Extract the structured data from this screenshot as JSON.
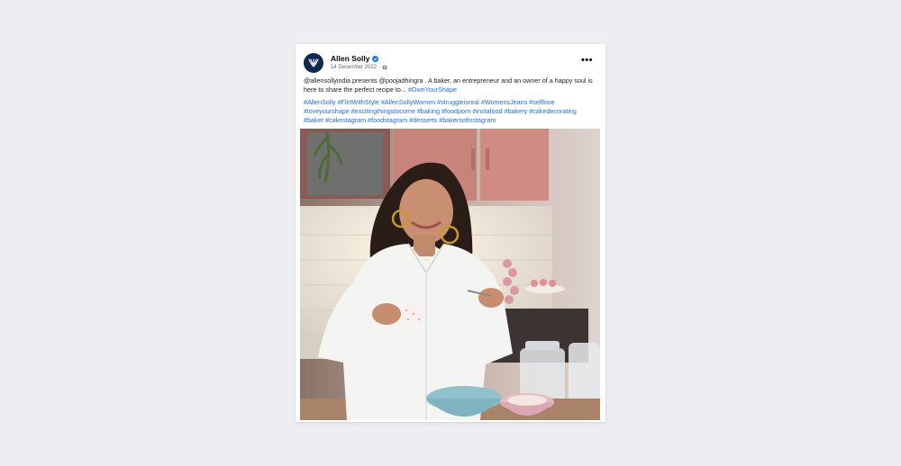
{
  "post": {
    "author": "Allen Solly",
    "date": "14 December 2022",
    "date_sep": "·",
    "more_glyph": "•••",
    "caption": {
      "mention_brand": "@allensollyindia",
      "presents": " presents ",
      "mention_person": "@poojadhingra",
      "text": " . A baker, an entrepreneur and an owner of a happy soul is here to share the perfect recipe to... ",
      "tag_own": "#OwnYourShape"
    },
    "hashtags": [
      "#AllenSolly",
      "#FlirtWithStyle",
      "#AllenSollyWomen",
      "#struggleisreal",
      "#WomensJeans",
      "#selflove",
      "#loveyourshape",
      "#excitingthingstocome",
      "#baking",
      "#foodporn",
      "#instafood",
      "#bakery",
      "#cakedecorating",
      "#baker",
      "#cakestagram",
      "#foodstagram",
      "#desserts",
      "#bakersofinstagram"
    ],
    "icons": {
      "avatar": "allen-solly-logo",
      "verified": "verified-badge-icon",
      "audience": "globe-icon",
      "more": "more-options-icon"
    },
    "colors": {
      "link": "#216fdb",
      "verified": "#1877f2",
      "avatar_bg": "#0e2a4f"
    }
  }
}
